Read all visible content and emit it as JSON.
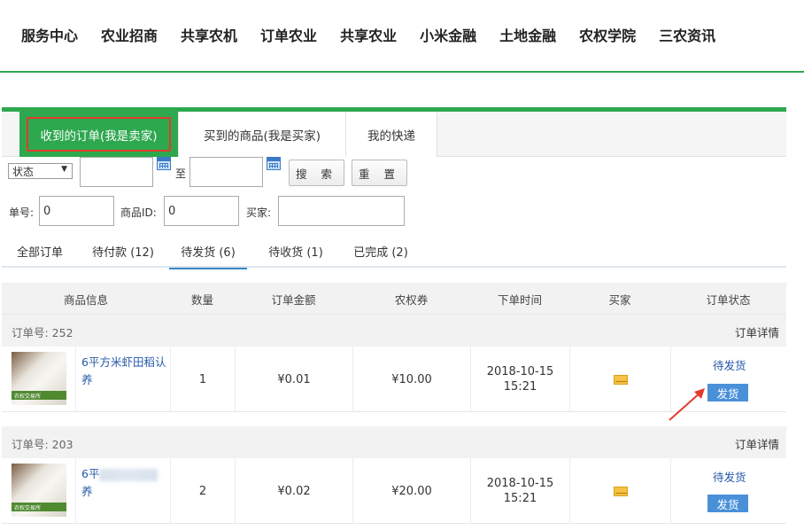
{
  "nav": [
    "服务中心",
    "农业招商",
    "共享农机",
    "订单农业",
    "共享农业",
    "小米金融",
    "土地金融",
    "农权学院",
    "三农资讯"
  ],
  "tabs": [
    "收到的订单(我是卖家)",
    "买到的商品(我是买家)",
    "我的快递"
  ],
  "filters": {
    "status_select": "状态",
    "to_label": "至",
    "search_button": "搜 索",
    "reset_button": "重 置",
    "order_no_label": "单号:",
    "order_no_value": "0",
    "product_id_label": "商品ID:",
    "product_id_value": "0",
    "buyer_label": "买家:",
    "buyer_value": ""
  },
  "status_tabs": [
    "全部订单",
    "待付款 (12)",
    "待发货 (6)",
    "待收货 (1)",
    "已完成 (2)"
  ],
  "active_status_tab": 2,
  "table_headers": [
    "商品信息",
    "数量",
    "订单金额",
    "农权券",
    "下单时间",
    "买家",
    "订单状态"
  ],
  "orders": [
    {
      "order_no": "订单号: 252",
      "detail_link": "订单详情",
      "product_name": "6平方米虾田稻认养",
      "thumb_text": "农权交易所",
      "quantity": "1",
      "amount": "¥0.01",
      "coupon": "¥10.00",
      "date": "2018-10-15",
      "time": "15:21",
      "status": "待发货",
      "ship_button": "发货"
    },
    {
      "order_no": "订单号: 203",
      "detail_link": "订单详情",
      "product_name_prefix": "6平",
      "product_name_suffix": "养",
      "thumb_text": "农权交易所",
      "quantity": "2",
      "amount": "¥0.02",
      "coupon": "¥20.00",
      "date": "2018-10-15",
      "time": "15:21",
      "status": "待发货",
      "ship_button": "发货"
    }
  ],
  "colors": {
    "brand_green": "#2ea84f",
    "highlight_red": "#e23a2c",
    "link_blue": "#2457a8",
    "button_blue": "#4a90d9"
  }
}
